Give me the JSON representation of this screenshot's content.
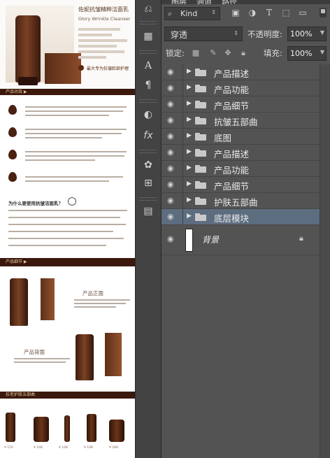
{
  "panel": {
    "tabs": [
      "图层",
      "通道",
      "路径"
    ],
    "filter_kind": "Kind",
    "blend_mode": "穿透",
    "opacity_label": "不透明度:",
    "opacity_value": "100%",
    "lock_label": "锁定:",
    "fill_label": "填充:",
    "fill_value": "100%",
    "layers": [
      {
        "name": "产品描述",
        "type": "group",
        "selected": false
      },
      {
        "name": "产品功能",
        "type": "group",
        "selected": false
      },
      {
        "name": "产品细节",
        "type": "group",
        "selected": false
      },
      {
        "name": "抗皱五部曲",
        "type": "group",
        "selected": false
      },
      {
        "name": "底图",
        "type": "group",
        "selected": false
      },
      {
        "name": "产品描述",
        "type": "group",
        "selected": false
      },
      {
        "name": "产品功能",
        "type": "group",
        "selected": false
      },
      {
        "name": "产品细节",
        "type": "group",
        "selected": false
      },
      {
        "name": "护肤五部曲",
        "type": "group",
        "selected": false
      },
      {
        "name": "底层模块",
        "type": "group",
        "selected": true
      }
    ],
    "background_layer": "背景"
  },
  "canvas": {
    "header_title": "佐妮抗皱精粹洁面乳",
    "header_subtitle": "Glory Wrinkle Cleanser",
    "header_slogan": "最大专为抗皱脸部护理",
    "band1_label": "产品功效 ▶",
    "band2_label": "产品细节 ▶",
    "band3_label": "抗老护肤五部曲",
    "why_title": "为什么要使用抗皱洁面乳？",
    "label_front": "产品正面",
    "label_back": "产品背面",
    "prices": [
      "¥ 150",
      "¥ 248",
      "¥ 168",
      "¥ 198",
      "¥ 268"
    ]
  },
  "colors": {
    "panel_bg": "#535353",
    "selected_row": "#5d6d80",
    "brand_brown": "#3b180c"
  }
}
